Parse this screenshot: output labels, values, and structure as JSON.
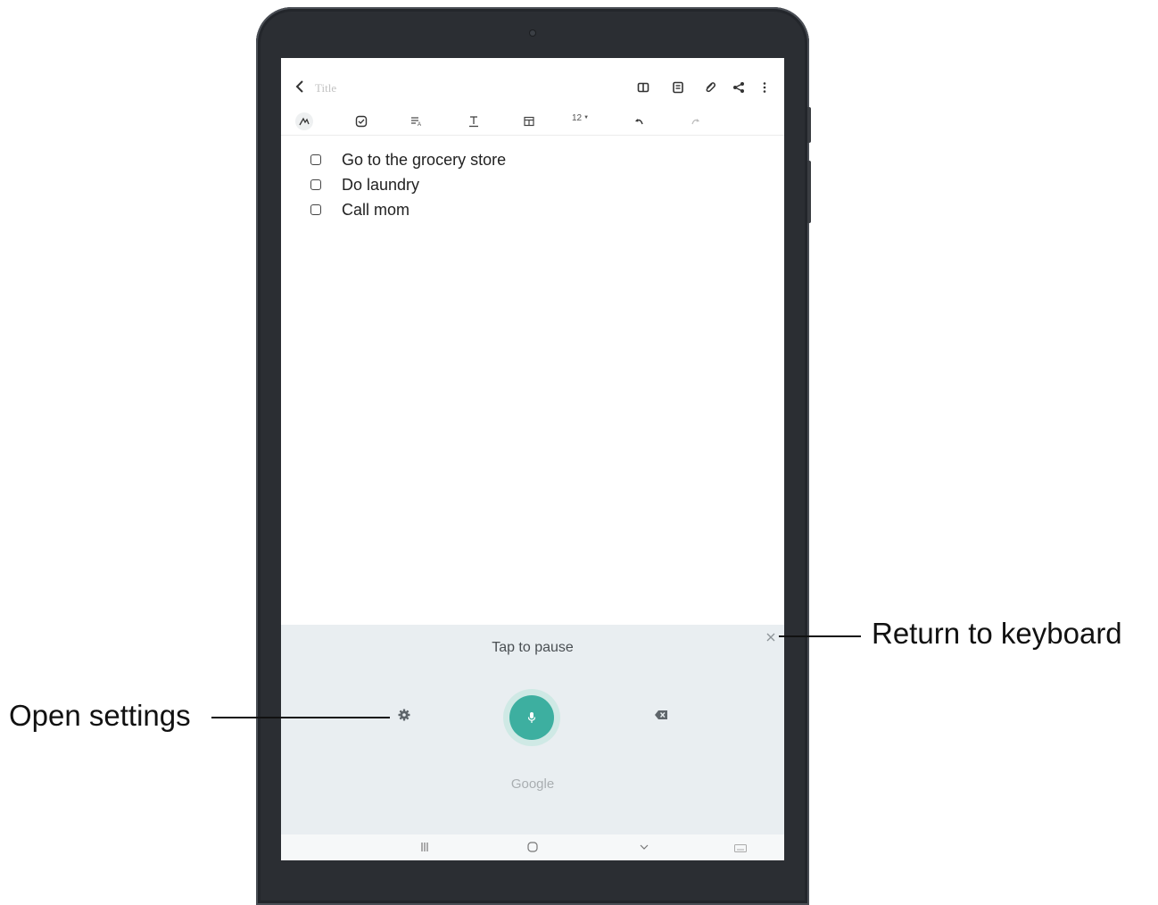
{
  "note": {
    "title_placeholder": "Title",
    "font_size": "12",
    "checklist": [
      {
        "text": "Go to the grocery store"
      },
      {
        "text": "Do laundry"
      },
      {
        "text": "Call mom"
      }
    ]
  },
  "voice_input": {
    "status": "Tap to pause",
    "provider": "Google",
    "mic_color": "#3dafa0"
  },
  "callouts": {
    "return_to_keyboard": "Return to keyboard",
    "open_settings": "Open settings"
  },
  "icons": [
    "back-icon",
    "split-view-icon",
    "notes-icon",
    "attach-icon",
    "share-icon",
    "more-icon",
    "pen-mode-icon",
    "checkbox-icon",
    "text-style-icon",
    "text-format-icon",
    "table-icon",
    "undo-icon",
    "redo-icon",
    "close-icon",
    "settings-icon",
    "mic-icon",
    "backspace-icon",
    "recent-apps-icon",
    "home-icon",
    "collapse-icon",
    "keyboard-icon"
  ]
}
